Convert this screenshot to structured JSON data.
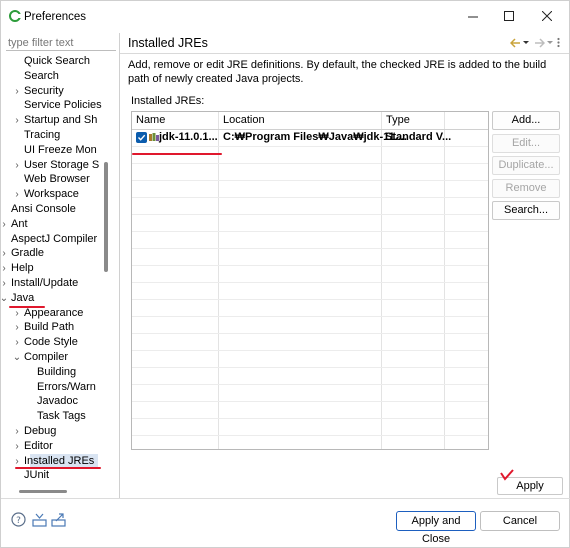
{
  "window": {
    "title": "Preferences"
  },
  "filter": {
    "placeholder": "type filter text"
  },
  "tree": [
    {
      "label": "Quick Search",
      "indent": 2,
      "arrow": ""
    },
    {
      "label": "Search",
      "indent": 2,
      "arrow": ""
    },
    {
      "label": "Security",
      "indent": 2,
      "arrow": "›"
    },
    {
      "label": "Service Policies",
      "indent": 2,
      "arrow": ""
    },
    {
      "label": "Startup and Sh",
      "indent": 2,
      "arrow": "›"
    },
    {
      "label": "Tracing",
      "indent": 2,
      "arrow": ""
    },
    {
      "label": "UI Freeze Mon",
      "indent": 2,
      "arrow": ""
    },
    {
      "label": "User Storage S",
      "indent": 2,
      "arrow": "›"
    },
    {
      "label": "Web Browser",
      "indent": 2,
      "arrow": ""
    },
    {
      "label": "Workspace",
      "indent": 2,
      "arrow": "›"
    },
    {
      "label": "Ansi Console",
      "indent": 1,
      "arrow": ""
    },
    {
      "label": "Ant",
      "indent": 1,
      "arrow": "›"
    },
    {
      "label": "AspectJ Compiler",
      "indent": 1,
      "arrow": ""
    },
    {
      "label": "Gradle",
      "indent": 1,
      "arrow": "›"
    },
    {
      "label": "Help",
      "indent": 1,
      "arrow": "›"
    },
    {
      "label": "Install/Update",
      "indent": 1,
      "arrow": "›"
    },
    {
      "label": "Java",
      "indent": 1,
      "arrow": "⌄"
    },
    {
      "label": "Appearance",
      "indent": 2,
      "arrow": "›"
    },
    {
      "label": "Build Path",
      "indent": 2,
      "arrow": "›"
    },
    {
      "label": "Code Style",
      "indent": 2,
      "arrow": "›"
    },
    {
      "label": "Compiler",
      "indent": 2,
      "arrow": "⌄"
    },
    {
      "label": "Building",
      "indent": 3,
      "arrow": ""
    },
    {
      "label": "Errors/Warn",
      "indent": 3,
      "arrow": ""
    },
    {
      "label": "Javadoc",
      "indent": 3,
      "arrow": ""
    },
    {
      "label": "Task Tags",
      "indent": 3,
      "arrow": ""
    },
    {
      "label": "Debug",
      "indent": 2,
      "arrow": "›"
    },
    {
      "label": "Editor",
      "indent": 2,
      "arrow": "›"
    },
    {
      "label": "Installed JREs",
      "indent": 2,
      "arrow": "›",
      "selected": true
    },
    {
      "label": "JUnit",
      "indent": 2,
      "arrow": ""
    }
  ],
  "main": {
    "title": "Installed JREs",
    "description": "Add, remove or edit JRE definitions. By default, the checked JRE is added to the build path of newly created Java projects.",
    "installed_label": "Installed JREs:",
    "columns": [
      "Name",
      "Location",
      "Type"
    ],
    "rows": [
      {
        "name": "jdk-11.0.1...",
        "location": "C:₩Program Files₩Java₩jdk-11....",
        "type": "Standard V...",
        "checked": true
      }
    ],
    "buttons": {
      "add": "Add...",
      "edit": "Edit...",
      "duplicate": "Duplicate...",
      "remove": "Remove",
      "search": "Search..."
    },
    "apply": "Apply"
  },
  "footer": {
    "apply_and_close": "Apply and Close",
    "cancel": "Cancel"
  },
  "colors": {
    "annotation": "#e0182d",
    "accent": "#0b5cad",
    "selection": "#d9e4f2"
  }
}
